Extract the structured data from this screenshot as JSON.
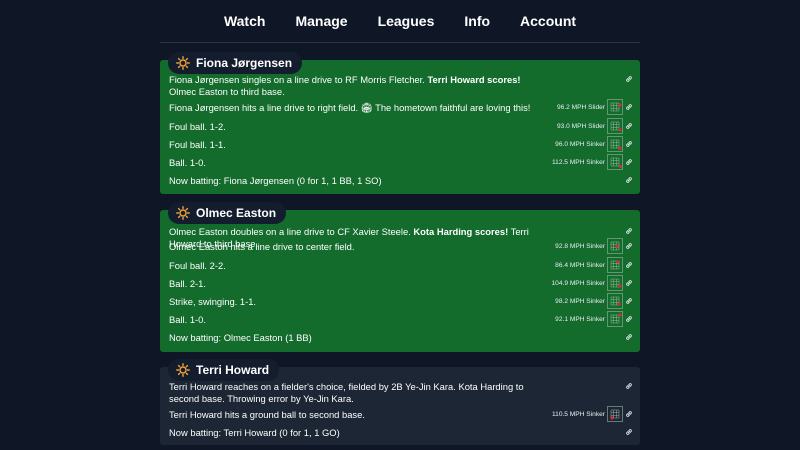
{
  "nav": {
    "items": [
      "Watch",
      "Manage",
      "Leagues",
      "Info",
      "Account"
    ]
  },
  "colors": {
    "background": "#0f1726",
    "card_green": "#136b2c",
    "card_dark": "#1c2635",
    "chip": "#141d2e",
    "sun": "#f2a33a",
    "zone_marker": "#e02a2a"
  },
  "plays": [
    {
      "batter": "Fiona Jørgensen",
      "rows": [
        {
          "pre": "Fiona Jørgensen singles on a line drive to RF Morris Fletcher. ",
          "bold": "Terri Howard scores!",
          "post": " Olmec Easton to third base.",
          "pitch": ""
        },
        {
          "pre": "Fiona Jørgensen hits a line drive to right field. 🏟 The hometown faithful are loving this!",
          "bold": "",
          "post": "",
          "pitch": "96.2 MPH Slider"
        },
        {
          "pre": "Foul ball. 1-2.",
          "bold": "",
          "post": "",
          "pitch": "93.0 MPH Slider"
        },
        {
          "pre": "Foul ball. 1-1.",
          "bold": "",
          "post": "",
          "pitch": "96.0 MPH Sinker"
        },
        {
          "pre": "Ball. 1-0.",
          "bold": "",
          "post": "",
          "pitch": "112.5 MPH Sinker"
        },
        {
          "pre": "Now batting: Fiona Jørgensen (0 for 1, 1 BB, 1 SO)",
          "bold": "",
          "post": "",
          "pitch": ""
        }
      ]
    },
    {
      "batter": "Olmec Easton",
      "rows": [
        {
          "pre": "Olmec Easton doubles on a line drive to CF Xavier Steele. ",
          "bold": "Kota Harding scores!",
          "post": " Terri Howard to third base.",
          "pitch": ""
        },
        {
          "pre": "Olmec Easton hits a line drive to center field.",
          "bold": "",
          "post": "",
          "pitch": "92.8 MPH Sinker"
        },
        {
          "pre": "Foul ball. 2-2.",
          "bold": "",
          "post": "",
          "pitch": "86.4 MPH Sinker"
        },
        {
          "pre": "Ball. 2-1.",
          "bold": "",
          "post": "",
          "pitch": "104.9 MPH Sinker"
        },
        {
          "pre": "Strike, swinging. 1-1.",
          "bold": "",
          "post": "",
          "pitch": "98.2 MPH Sinker"
        },
        {
          "pre": "Ball. 1-0.",
          "bold": "",
          "post": "",
          "pitch": "92.1 MPH Sinker"
        },
        {
          "pre": "Now batting: Olmec Easton (1 BB)",
          "bold": "",
          "post": "",
          "pitch": ""
        }
      ]
    },
    {
      "batter": "Terri Howard",
      "rows": [
        {
          "pre": "Terri Howard reaches on a fielder's choice, fielded by 2B Ye-Jin Kara. Kota Harding to second base. Throwing error by Ye-Jin Kara.",
          "bold": "",
          "post": "",
          "pitch": ""
        },
        {
          "pre": "Terri Howard hits a ground ball to second base.",
          "bold": "",
          "post": "",
          "pitch": "110.5 MPH Sinker"
        },
        {
          "pre": "Now batting: Terri Howard (0 for 1, 1 GO)",
          "bold": "",
          "post": "",
          "pitch": ""
        }
      ]
    }
  ]
}
